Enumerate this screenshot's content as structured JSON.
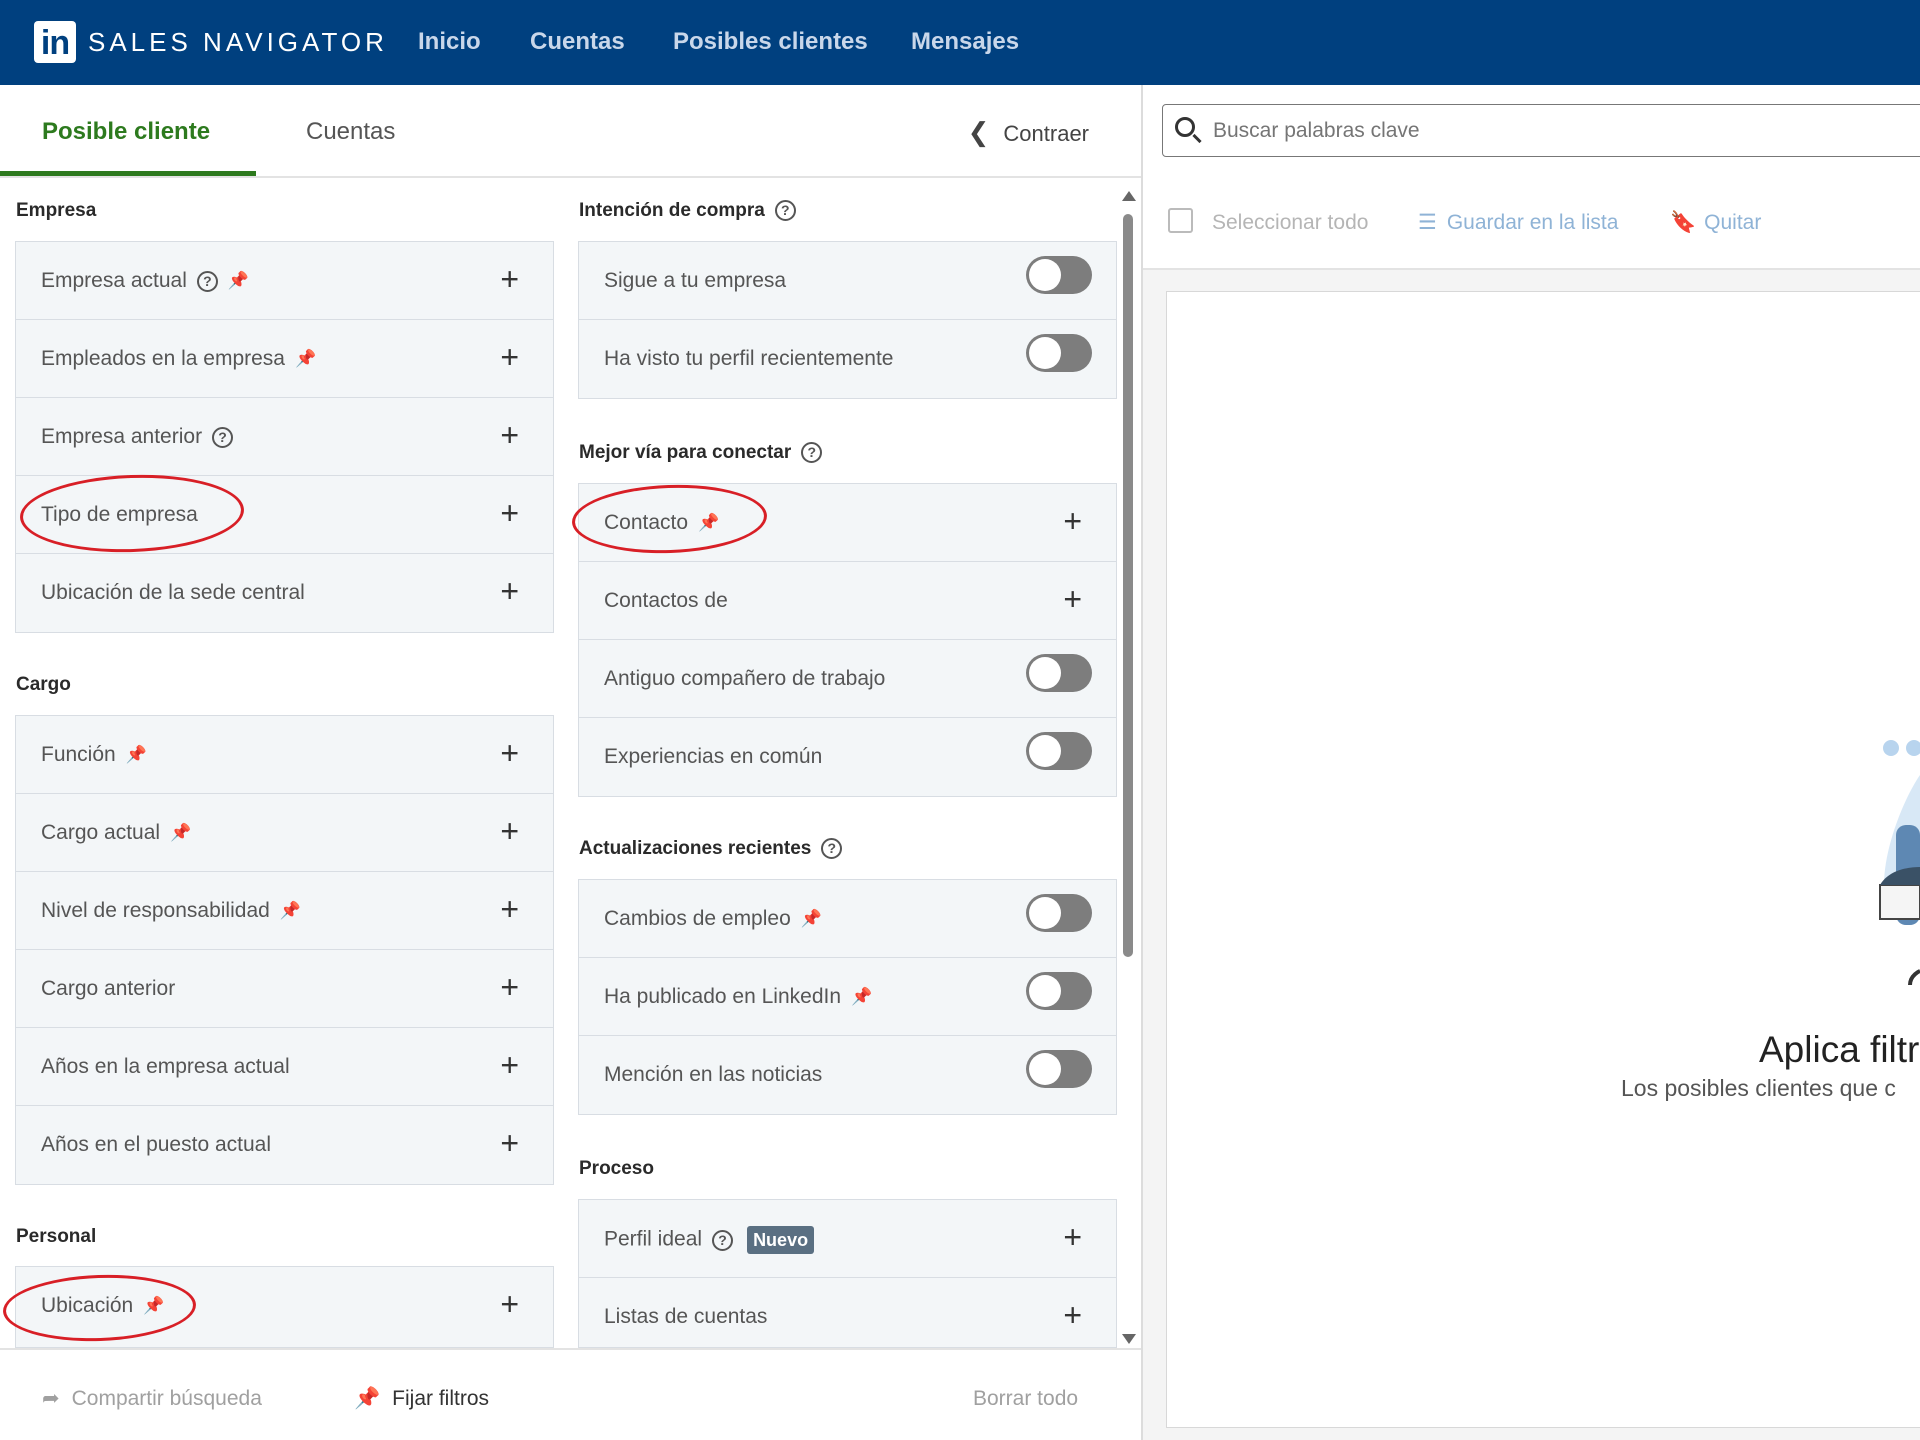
{
  "header": {
    "logo_text": "in",
    "brand": "SALES NAVIGATOR",
    "nav": [
      "Inicio",
      "Cuentas",
      "Posibles clientes",
      "Mensajes"
    ]
  },
  "tabs": {
    "active": "Posible cliente",
    "inactive": "Cuentas",
    "collapse": "Contraer"
  },
  "left_column": {
    "empresa": {
      "title": "Empresa",
      "rows": [
        "Empresa actual",
        "Empleados en la empresa",
        "Empresa anterior",
        "Tipo de empresa",
        "Ubicación de la sede central"
      ]
    },
    "cargo": {
      "title": "Cargo",
      "rows": [
        "Función",
        "Cargo actual",
        "Nivel de responsabilidad",
        "Cargo anterior",
        "Años en la empresa actual",
        "Años en el puesto actual"
      ]
    },
    "personal": {
      "title": "Personal",
      "rows": [
        "Ubicación"
      ]
    }
  },
  "right_column": {
    "intencion": {
      "title": "Intención de compra",
      "rows": [
        "Sigue a tu empresa",
        "Ha visto tu perfil recientemente"
      ]
    },
    "mejor_via": {
      "title": "Mejor vía para conectar",
      "rows": [
        "Contacto",
        "Contactos de",
        "Antiguo compañero de trabajo",
        "Experiencias en común"
      ]
    },
    "actualizaciones": {
      "title": "Actualizaciones recientes",
      "rows": [
        "Cambios de empleo",
        "Ha publicado en LinkedIn",
        "Mención en las noticias"
      ]
    },
    "proceso": {
      "title": "Proceso",
      "rows": [
        "Perfil ideal",
        "Listas de cuentas"
      ],
      "badge": "Nuevo"
    }
  },
  "footer": {
    "share": "Compartir búsqueda",
    "pin": "Fijar filtros",
    "clear": "Borrar todo"
  },
  "results_panel": {
    "search_placeholder": "Buscar palabras clave",
    "select_all": "Seleccionar todo",
    "save_to_list": "Guardar en la lista",
    "remove": "Quitar",
    "empty_title": "Aplica filtr",
    "empty_subtitle": "Los posibles clientes que c"
  },
  "colors": {
    "header_bg": "#00407f",
    "active_tab": "#2d7a1e",
    "annotation": "#d81f26",
    "card_bg": "#f3f6f8"
  },
  "toggles": {
    "sigue_a_tu_empresa": false,
    "ha_visto_tu_perfil": false,
    "antiguo_companero": false,
    "experiencias_en_comun": false,
    "cambios_de_empleo": false,
    "ha_publicado": false,
    "mencion_noticias": false
  },
  "icons": [
    "linkedin-logo-icon",
    "help-circle-icon",
    "pin-icon",
    "plus-icon",
    "chevron-left-icon",
    "search-icon",
    "list-icon",
    "bookmark-icon",
    "share-arrow-icon"
  ]
}
